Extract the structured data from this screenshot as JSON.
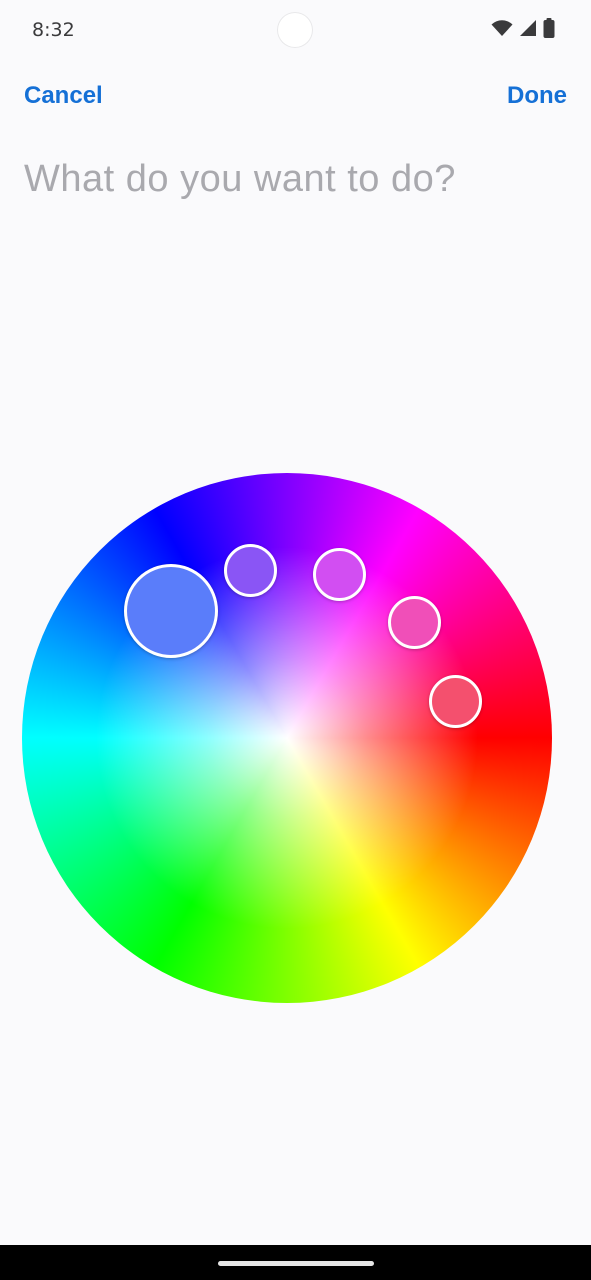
{
  "status_bar": {
    "time": "8:32",
    "icons": [
      "wifi-icon",
      "cellular-signal-icon",
      "battery-icon"
    ]
  },
  "nav": {
    "cancel_label": "Cancel",
    "done_label": "Done",
    "accent_color": "#1570d6"
  },
  "title_field": {
    "placeholder": "What do you want to do?",
    "value": ""
  },
  "color_wheel": {
    "selected_swatch_index": 0,
    "swatches": [
      {
        "color": "#5a7dfa",
        "selected": true
      },
      {
        "color": "#8a55f5",
        "selected": false
      },
      {
        "color": "#d24ef2",
        "selected": false
      },
      {
        "color": "#f04fb8",
        "selected": false
      },
      {
        "color": "#f4506e",
        "selected": false
      }
    ]
  }
}
